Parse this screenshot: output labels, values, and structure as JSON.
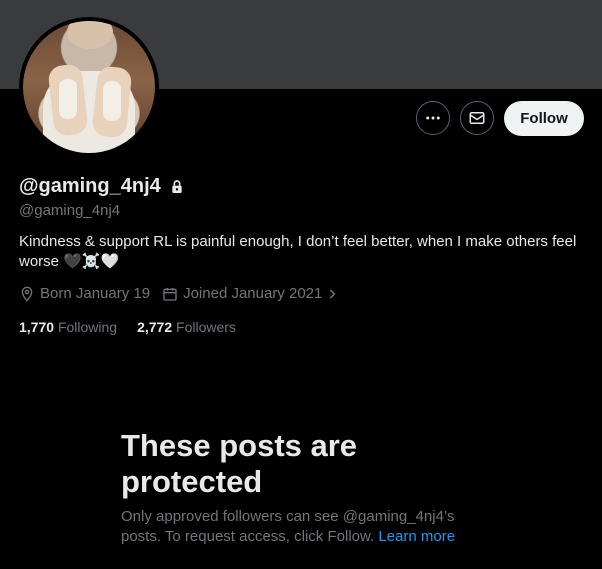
{
  "profile": {
    "display_name": "@gaming_4nj4",
    "handle": "@gaming_4nj4",
    "bio": "Kindness & support RL is painful enough, I don’t feel better, when I make others feel worse 🖤☠️🤍",
    "birthday": "Born January 19",
    "joined": "Joined January 2021",
    "following_count": "1,770",
    "following_label": "Following",
    "followers_count": "2,772",
    "followers_label": "Followers"
  },
  "actions": {
    "follow_label": "Follow",
    "more_icon": "more-icon",
    "message_icon": "envelope-icon"
  },
  "protected": {
    "title": "These posts are protected",
    "body": "Only approved followers can see @gaming_4nj4’s posts. To request access, click Follow.",
    "link": "Learn more"
  },
  "colors": {
    "background": "#000000",
    "banner": "#3a3b3c",
    "link": "#1d9bf0",
    "muted": "#71767b"
  }
}
